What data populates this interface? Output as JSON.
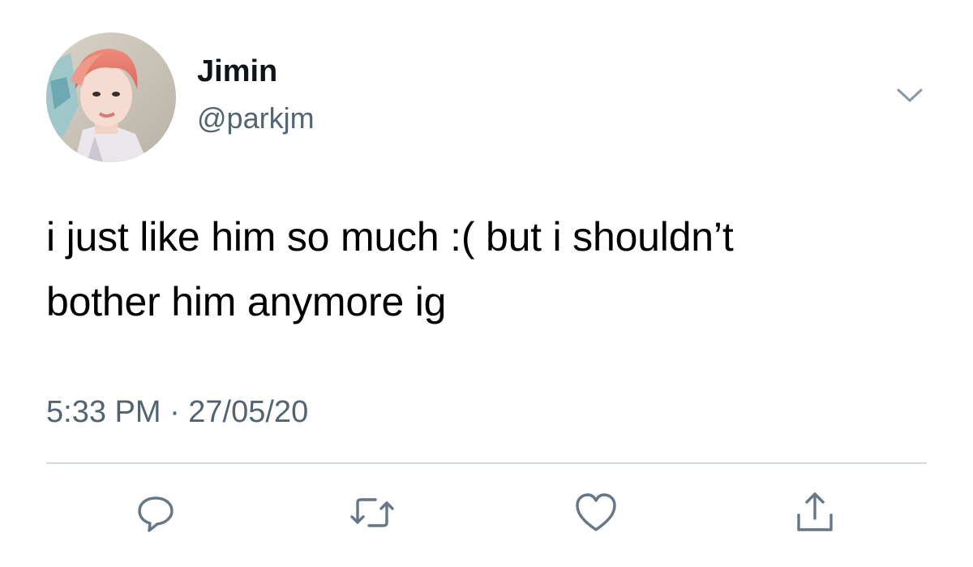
{
  "tweet": {
    "display_name": "Jimin",
    "handle": "@parkjm",
    "text_lines": [
      "i just like him so much :( but i shouldn’t",
      "bother him anymore ig"
    ],
    "timestamp": "5:33 PM · 27/05/20"
  },
  "actions": {
    "reply": "reply-icon",
    "retweet": "retweet-icon",
    "like": "heart-icon",
    "share": "share-icon"
  },
  "colors": {
    "text": "#000000",
    "secondary_text": "#536471",
    "icon": "#657786",
    "divider": "#cfd9de",
    "background": "#ffffff"
  }
}
